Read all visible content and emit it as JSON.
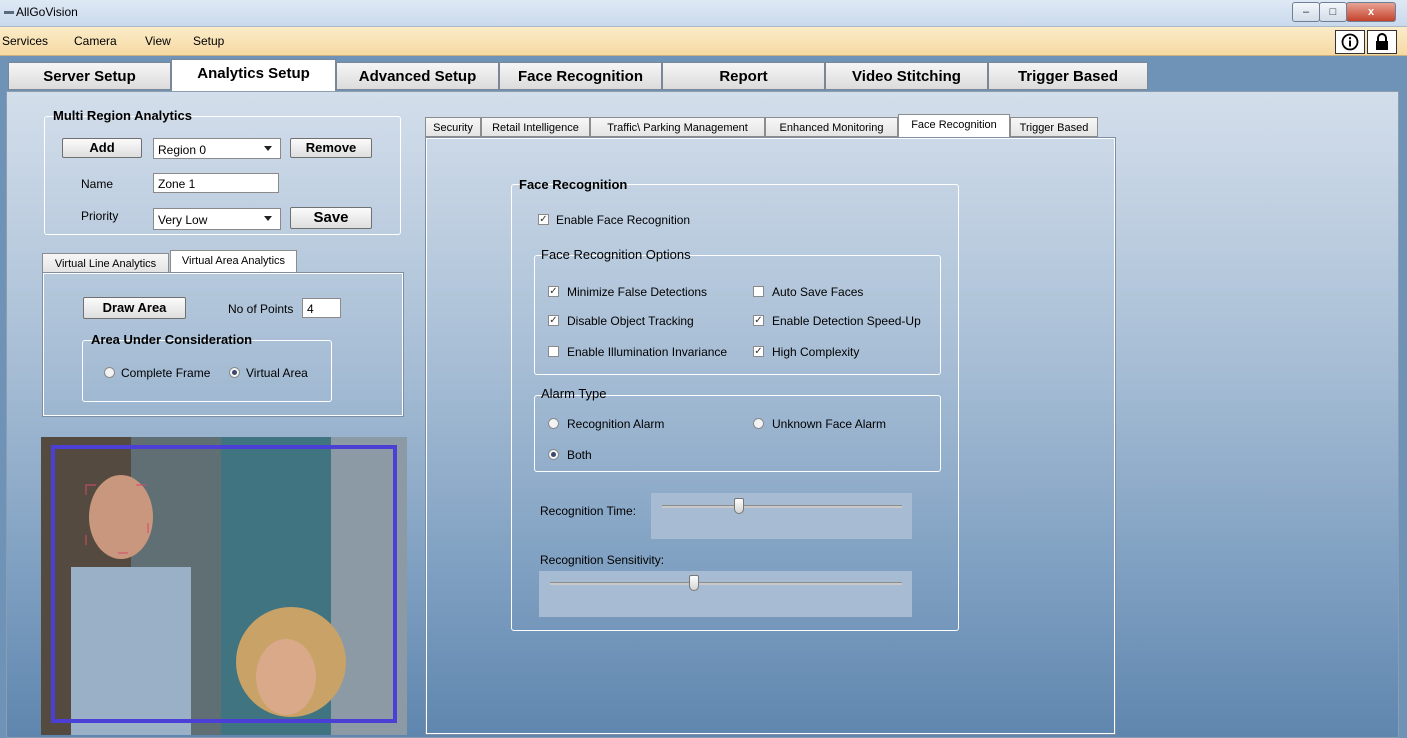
{
  "window": {
    "title": "AllGoVision",
    "minimize": "–",
    "maximize": "□",
    "close": "x"
  },
  "menu": [
    "Services",
    "Camera",
    "View",
    "Setup"
  ],
  "header_icons": {
    "info": "info-icon",
    "lock": "lock-icon"
  },
  "top_tabs": [
    "Server Setup",
    "Analytics Setup",
    "Advanced Setup",
    "Face Recognition",
    "Report",
    "Video Stitching",
    "Trigger Based"
  ],
  "multi_region": {
    "title": "Multi Region Analytics",
    "add_label": "Add",
    "region_value": "Region 0",
    "remove_label": "Remove",
    "name_label": "Name",
    "name_value": "Zone 1",
    "priority_label": "Priority",
    "priority_value": "Very Low",
    "save_label": "Save"
  },
  "analytics_tabs": [
    "Virtual Line Analytics",
    "Virtual Area Analytics"
  ],
  "virtual_area": {
    "draw_label": "Draw Area",
    "points_label": "No of Points",
    "points_value": "4",
    "area_title": "Area Under Consideration",
    "opt_complete": "Complete Frame",
    "opt_virtual": "Virtual Area",
    "selected": "Virtual Area"
  },
  "category_tabs": [
    "Security",
    "Retail Intelligence",
    "Traffic\\ Parking Management",
    "Enhanced Monitoring",
    "Face Recognition",
    "Trigger Based"
  ],
  "face_recognition": {
    "title": "Face Recognition",
    "enable_label": "Enable Face Recognition",
    "enable_checked": true,
    "options_title": "Face Recognition Options",
    "options": {
      "minimize": {
        "label": "Minimize False Detections",
        "checked": true
      },
      "auto_save": {
        "label": "Auto Save Faces",
        "checked": false
      },
      "disable_tracking": {
        "label": "Disable Object Tracking",
        "checked": true
      },
      "speed_up": {
        "label": "Enable Detection Speed-Up",
        "checked": true
      },
      "illumination": {
        "label": "Enable Illumination Invariance",
        "checked": false
      },
      "high_complexity": {
        "label": "High Complexity",
        "checked": true
      }
    },
    "alarm_title": "Alarm Type",
    "alarm_recognition": "Recognition Alarm",
    "alarm_unknown": "Unknown Face Alarm",
    "alarm_both": "Both",
    "alarm_selected": "Both",
    "recognition_time_label": "Recognition Time:",
    "recognition_time_value": 0.32,
    "sensitivity_label": "Recognition Sensitivity:",
    "sensitivity_value": 0.41
  },
  "colors": {
    "menubar": "#f6d9a2",
    "content_top": "#d3deeb",
    "content_bottom": "#5f86ae",
    "roi": "#4b3fd6"
  }
}
